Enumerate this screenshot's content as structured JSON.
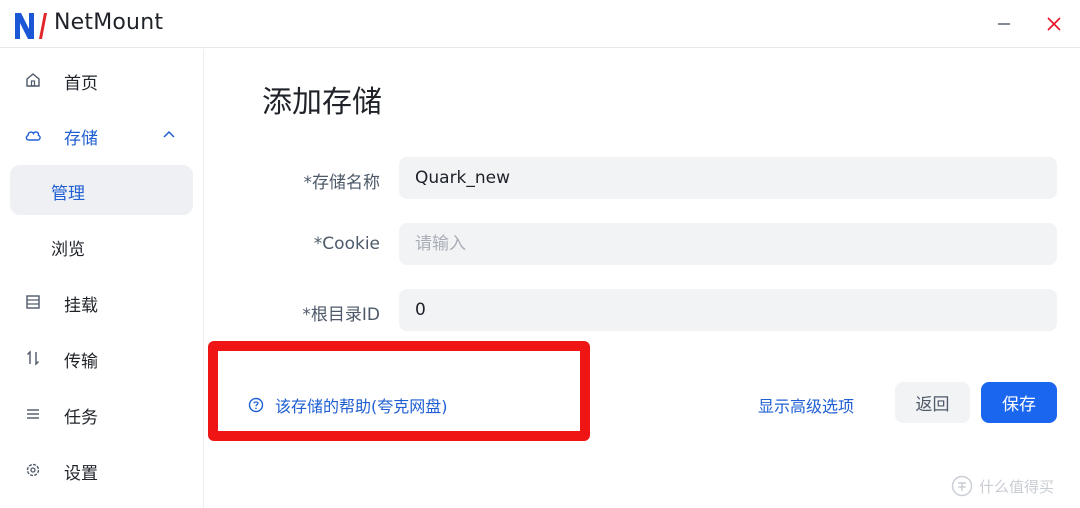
{
  "window": {
    "title": "NetMount",
    "minimize_icon": "minimize-icon",
    "close_icon": "close-icon",
    "close_color": "#e81123"
  },
  "sidebar": {
    "items": [
      {
        "label": "首页",
        "icon": "home-icon"
      },
      {
        "label": "存储",
        "icon": "cloud-icon",
        "expanded": true
      },
      {
        "label": "管理",
        "selected": true
      },
      {
        "label": "浏览"
      },
      {
        "label": "挂载",
        "icon": "mount-icon"
      },
      {
        "label": "传输",
        "icon": "transfer-icon"
      },
      {
        "label": "任务",
        "icon": "task-list-icon"
      },
      {
        "label": "设置",
        "icon": "gear-icon"
      }
    ]
  },
  "main": {
    "title": "添加存储",
    "form": {
      "name_label": "*存储名称",
      "name_value": "Quark_new",
      "cookie_label": "*Cookie",
      "cookie_placeholder": "请输入",
      "root_label": "*根目录ID",
      "root_value": "0"
    },
    "help_link": "该存储的帮助(夸克网盘)",
    "advanced_link": "显示高级选项",
    "back_button": "返回",
    "save_button": "保存"
  },
  "watermark": "什么值得买",
  "colors": {
    "accent": "#1f5fd3",
    "primary_button": "#1a66ee",
    "highlight": "#f01515",
    "input_bg": "#f2f3f5"
  }
}
